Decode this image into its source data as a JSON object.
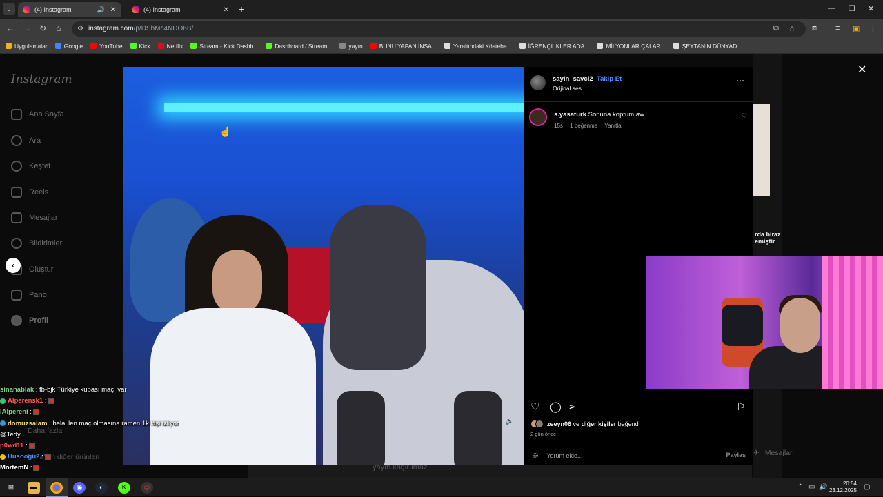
{
  "browser": {
    "tabs": [
      {
        "label": "(4) Instagram",
        "active": true
      },
      {
        "label": "(4) Instagram",
        "active": false
      }
    ],
    "url_host": "instagram.com",
    "url_path": "/p/DShMc4NDO6B/",
    "bookmarks": [
      {
        "label": "Uygulamalar",
        "icon": "apps-grid-icon",
        "color": "#f4b400"
      },
      {
        "label": "Google",
        "icon": "google-icon",
        "color": "#4285f4"
      },
      {
        "label": "YouTube",
        "icon": "youtube-icon",
        "color": "#ff0000"
      },
      {
        "label": "Kick",
        "icon": "kick-icon",
        "color": "#53fc18"
      },
      {
        "label": "Netflix",
        "icon": "netflix-icon",
        "color": "#e50914"
      },
      {
        "label": "Stream - Kick Dashb...",
        "icon": "kick-icon",
        "color": "#53fc18"
      },
      {
        "label": "Dashboard / Stream...",
        "icon": "kick-icon",
        "color": "#53fc18"
      },
      {
        "label": "yayın",
        "icon": "folder-icon",
        "color": "#888888"
      },
      {
        "label": "BUNU YAPAN İNSA...",
        "icon": "youtube-icon",
        "color": "#ff0000"
      },
      {
        "label": "Yeraltındaki Köstebe...",
        "icon": "globe-icon",
        "color": "#dddddd"
      },
      {
        "label": "İĞRENÇLİKLER ADA...",
        "icon": "globe-icon",
        "color": "#dddddd"
      },
      {
        "label": "MİLYONLAR ÇALAR...",
        "icon": "globe-icon",
        "color": "#dddddd"
      },
      {
        "label": "ŞEYTANIN DÜNYAD...",
        "icon": "globe-icon",
        "color": "#dddddd"
      }
    ]
  },
  "sidebar": {
    "logo": "Instagram",
    "items": [
      {
        "label": "Ana Sayfa",
        "icon": "home-icon"
      },
      {
        "label": "Ara",
        "icon": "search-icon"
      },
      {
        "label": "Keşfet",
        "icon": "compass-icon"
      },
      {
        "label": "Reels",
        "icon": "reels-icon"
      },
      {
        "label": "Mesajlar",
        "icon": "messages-icon"
      },
      {
        "label": "Bildirimler",
        "icon": "heart-icon"
      },
      {
        "label": "Oluştur",
        "icon": "create-icon"
      },
      {
        "label": "Pano",
        "icon": "dashboard-icon"
      },
      {
        "label": "Profil",
        "icon": "profile-avatar"
      }
    ],
    "more_items": [
      "Daha fazla",
      "Meta'nın diğer ürünleri"
    ]
  },
  "post": {
    "username": "sayin_savci2",
    "follow": "Takip Et",
    "audio": "Orijinal ses",
    "comment": {
      "user": "s.yasaturk",
      "text": "Sonuna koptum aw",
      "time": "15s",
      "likes": "1 beğenme",
      "reply": "Yanıtla"
    },
    "liked_by_user": "zeeyn06",
    "liked_by_rest": "ve",
    "liked_by_others": "diğer kişiler",
    "liked_suffix": "beğendi",
    "ago": "2 gün önce",
    "add_comment_placeholder": "Yorum ekle...",
    "share": "Paylaş"
  },
  "background": {
    "caption": "rda biraz\nemiştir",
    "messages_tab": "Mesajlar",
    "bottom_caption": "yayın kaçırılmaz"
  },
  "chat": [
    {
      "user": "sinanablak",
      "color": "#7bd38a",
      "text": ": fb-bjk Türkiye kupası maçı var"
    },
    {
      "user": "Alperensk1",
      "color": "#ff5a5a",
      "text": ":",
      "badge_color": "#2ecc71"
    },
    {
      "user": "lAlpereni",
      "color": "#7bd38a",
      "text": ":"
    },
    {
      "user": "domuzsalam",
      "color": "#f5d76e",
      "text": ": helal len maç olmasına ramen 1k kişi izliyor @Tedy",
      "badge_color": "#3498db"
    },
    {
      "user": "p0wd11",
      "color": "#ff5a5a",
      "text": ":"
    },
    {
      "user": "Husoogu2",
      "color": "#4c8dff",
      "text": ":",
      "badge_color": "#f1c40f"
    },
    {
      "user": "MortemN",
      "color": "#ffffff",
      "text": ":"
    }
  ],
  "taskbar": {
    "time": "20:54",
    "date": "23.12.2025"
  }
}
